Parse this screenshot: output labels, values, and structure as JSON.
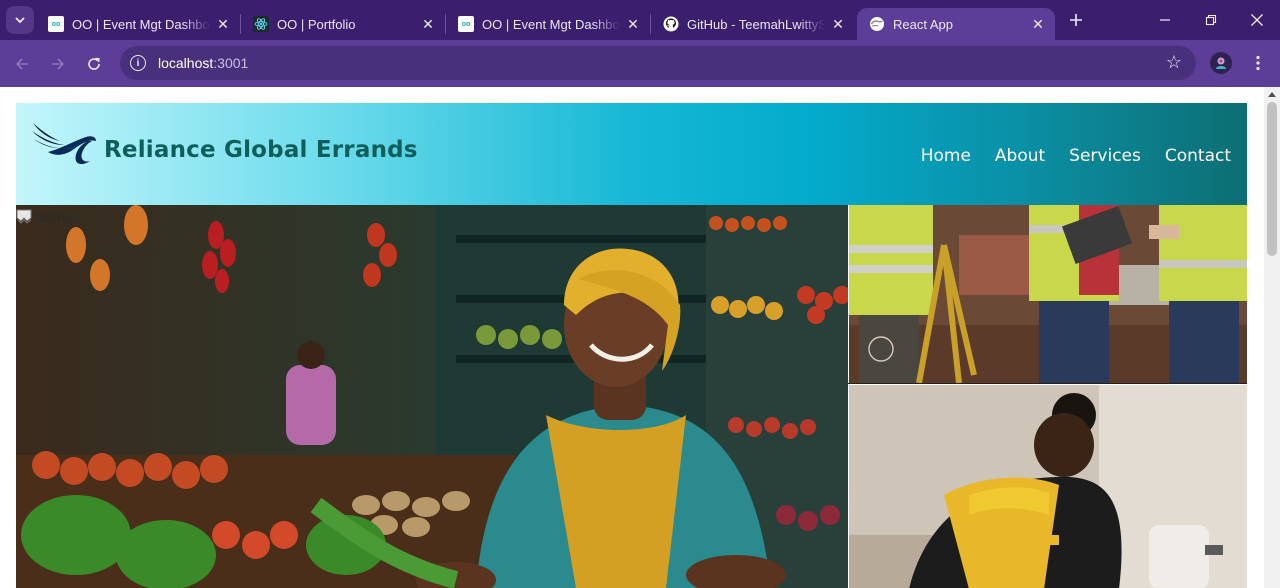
{
  "browser": {
    "tabs": [
      {
        "title": "OO | Event Mgt Dashboard",
        "icon": "oo-favicon",
        "active": false
      },
      {
        "title": "OO | Portfolio",
        "icon": "react-favicon",
        "active": false
      },
      {
        "title": "OO | Event Mgt Dashboard",
        "icon": "oo-favicon",
        "active": false
      },
      {
        "title": "GitHub - TeemahLwittySw",
        "icon": "github-favicon",
        "active": false
      },
      {
        "title": "React App",
        "icon": "react-app-favicon",
        "active": true
      }
    ],
    "address": {
      "host": "localhost",
      "port": ":3001"
    },
    "theme_color": "#5c3d98"
  },
  "site": {
    "brand_name": "Reliance Global Errands",
    "nav": [
      "Home",
      "About",
      "Services",
      "Contact"
    ],
    "banner_alt": "banner"
  }
}
